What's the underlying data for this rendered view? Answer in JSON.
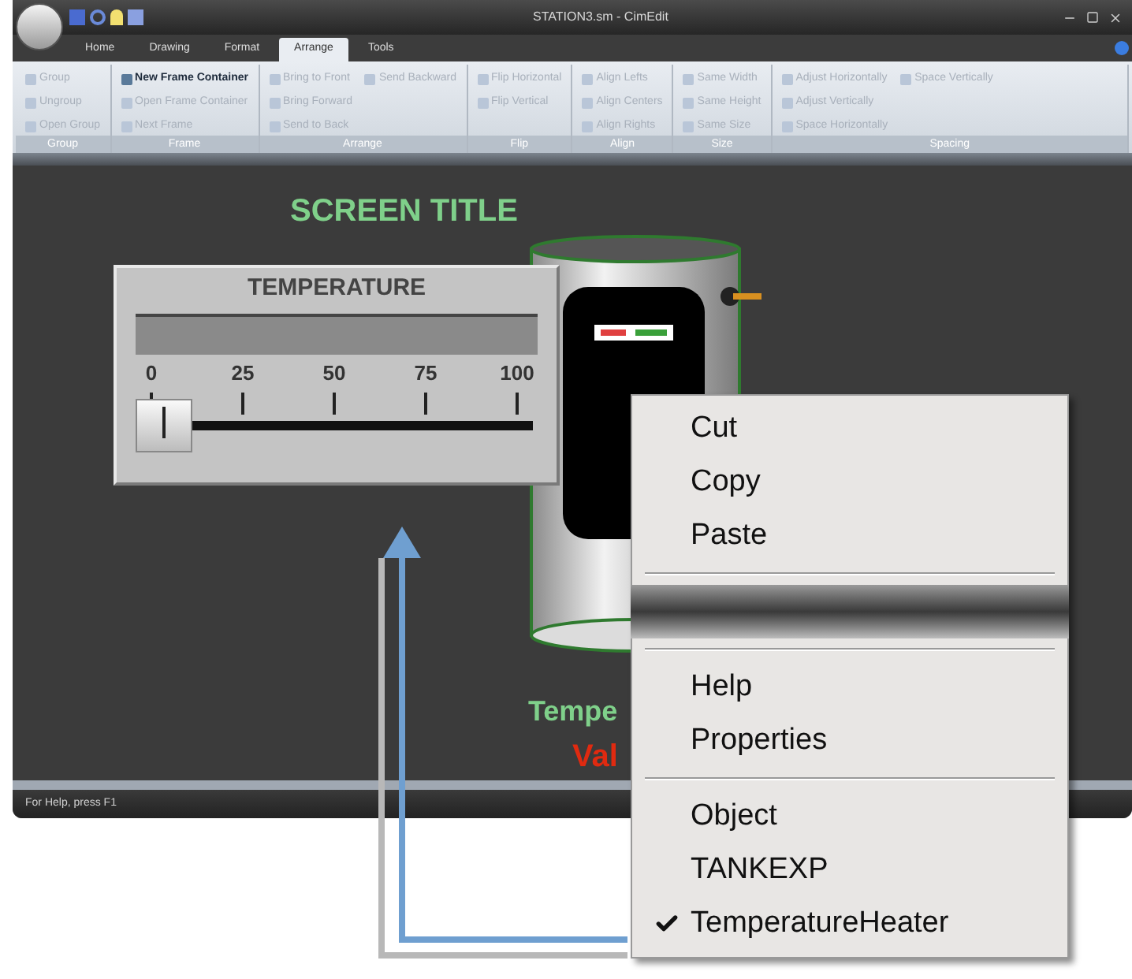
{
  "window": {
    "title": "STATION3.sm - CimEdit"
  },
  "tabs": [
    {
      "label": "Home",
      "selected": false
    },
    {
      "label": "Drawing",
      "selected": false
    },
    {
      "label": "Format",
      "selected": false
    },
    {
      "label": "Arrange",
      "selected": true
    },
    {
      "label": "Tools",
      "selected": false
    }
  ],
  "ribbon": {
    "groups": [
      {
        "label": "Group",
        "items": [
          {
            "label": "Group",
            "disabled": true
          },
          {
            "label": "Ungroup",
            "disabled": true
          },
          {
            "label": "Open Group",
            "disabled": true
          }
        ]
      },
      {
        "label": "Frame",
        "items": [
          {
            "label": "New Frame Container",
            "disabled": false
          },
          {
            "label": "Open Frame Container",
            "disabled": true
          },
          {
            "label": "Next Frame",
            "disabled": true
          }
        ]
      },
      {
        "label": "Arrange",
        "items": [
          {
            "label": "Bring to Front",
            "disabled": true
          },
          {
            "label": "Bring Forward",
            "disabled": true
          },
          {
            "label": "Send to Back",
            "disabled": true
          },
          {
            "label": "Send Backward",
            "disabled": true
          }
        ]
      },
      {
        "label": "Flip",
        "items": [
          {
            "label": "Flip Horizontal",
            "disabled": true
          },
          {
            "label": "Flip Vertical",
            "disabled": true
          }
        ]
      },
      {
        "label": "Align",
        "items": [
          {
            "label": "Align Lefts",
            "disabled": true
          },
          {
            "label": "Align Centers",
            "disabled": true
          },
          {
            "label": "Align Rights",
            "disabled": true
          }
        ]
      },
      {
        "label": "Size",
        "items": [
          {
            "label": "Same Width",
            "disabled": true
          },
          {
            "label": "Same Height",
            "disabled": true
          },
          {
            "label": "Same Size",
            "disabled": true
          }
        ]
      },
      {
        "label": "Spacing",
        "items": [
          {
            "label": "Adjust Horizontally",
            "disabled": true
          },
          {
            "label": "Adjust Vertically",
            "disabled": true
          },
          {
            "label": "Space Horizontally",
            "disabled": true
          },
          {
            "label": "Space Vertically",
            "disabled": true
          }
        ]
      }
    ]
  },
  "canvas": {
    "screen_title": "SCREEN TITLE",
    "temperature_panel": {
      "title": "TEMPERATURE",
      "scale": [
        "0",
        "25",
        "50",
        "75",
        "100"
      ],
      "level": 0
    },
    "label_1": "Tempe",
    "label_2": "Val"
  },
  "status_bar": "For Help, press F1",
  "context_menu": [
    {
      "kind": "item",
      "label": "Cut",
      "checked": false
    },
    {
      "kind": "item",
      "label": "Copy",
      "checked": false
    },
    {
      "kind": "item",
      "label": "Paste",
      "checked": false
    },
    {
      "kind": "separator"
    },
    {
      "kind": "torn"
    },
    {
      "kind": "separator"
    },
    {
      "kind": "item",
      "label": "Help",
      "checked": false
    },
    {
      "kind": "item",
      "label": "Properties",
      "checked": false
    },
    {
      "kind": "separator"
    },
    {
      "kind": "item",
      "label": "Object",
      "checked": false
    },
    {
      "kind": "item",
      "label": "TANKEXP",
      "checked": false
    },
    {
      "kind": "item",
      "label": "TemperatureHeater",
      "checked": true
    }
  ]
}
